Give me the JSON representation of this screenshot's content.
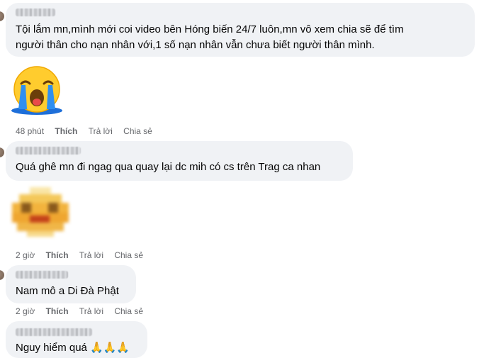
{
  "comments": [
    {
      "text_line1": "Tội lắm mn,mình mới coi video bên Hóng biến 24/7 luôn,mn vô xem chia sẽ để tìm",
      "text_line2": "người thân cho nạn nhân với,1 số nạn nhân vẫn chưa biết người thân mình.",
      "time": "48 phút",
      "like": "Thích",
      "reply": "Trả lời",
      "share": "Chia sẻ"
    },
    {
      "text": "Quá ghê mn đi ngag qua quay lại dc mih có cs trên Trag ca nhan",
      "time": "2 giờ",
      "like": "Thích",
      "reply": "Trả lời",
      "share": "Chia sẻ"
    },
    {
      "text": "Nam mô a Di Đà Phật",
      "time": "2 giờ",
      "like": "Thích",
      "reply": "Trả lời",
      "share": "Chia sẻ"
    },
    {
      "text": "Nguy hiểm quá 🙏🙏🙏"
    }
  ],
  "icons": {
    "crying_sticker": "crying-face-icon",
    "blurred_sticker": "pixelated-sticker-icon"
  }
}
